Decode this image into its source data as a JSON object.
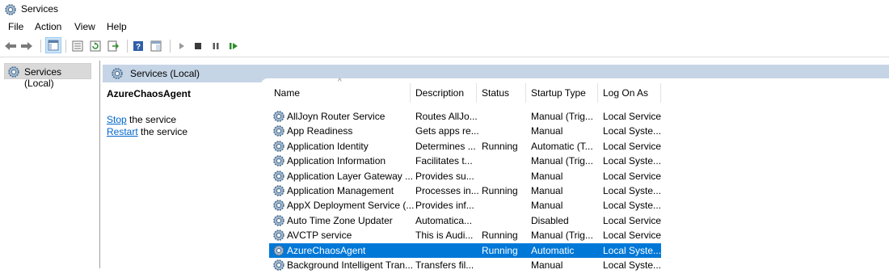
{
  "window": {
    "title": "Services"
  },
  "menu": [
    "File",
    "Action",
    "View",
    "Help"
  ],
  "toolbar": {
    "icons": [
      "back-arrow-icon",
      "forward-arrow-icon",
      "show-hide-tree-icon",
      "properties-icon",
      "refresh-icon",
      "export-list-icon",
      "help-icon",
      "console-view-icon",
      "start-service-icon",
      "stop-service-icon",
      "pause-service-icon",
      "restart-service-icon"
    ]
  },
  "tree": {
    "root_label": "Services (Local)"
  },
  "content_header": {
    "label": "Services (Local)"
  },
  "detail": {
    "service_name": "AzureChaosAgent",
    "stop_link": "Stop",
    "stop_rest": " the service",
    "restart_link": "Restart",
    "restart_rest": " the service"
  },
  "columns": [
    "Name",
    "Description",
    "Status",
    "Startup Type",
    "Log On As"
  ],
  "sort_indicator": "^",
  "services": [
    {
      "name": "AllJoyn Router Service",
      "description": "Routes AllJo...",
      "status": "",
      "startup": "Manual (Trig...",
      "logon": "Local Service"
    },
    {
      "name": "App Readiness",
      "description": "Gets apps re...",
      "status": "",
      "startup": "Manual",
      "logon": "Local Syste..."
    },
    {
      "name": "Application Identity",
      "description": "Determines ...",
      "status": "Running",
      "startup": "Automatic (T...",
      "logon": "Local Service"
    },
    {
      "name": "Application Information",
      "description": "Facilitates t...",
      "status": "",
      "startup": "Manual (Trig...",
      "logon": "Local Syste..."
    },
    {
      "name": "Application Layer Gateway ...",
      "description": "Provides su...",
      "status": "",
      "startup": "Manual",
      "logon": "Local Service"
    },
    {
      "name": "Application Management",
      "description": "Processes in...",
      "status": "Running",
      "startup": "Manual",
      "logon": "Local Syste..."
    },
    {
      "name": "AppX Deployment Service (...",
      "description": "Provides inf...",
      "status": "",
      "startup": "Manual",
      "logon": "Local Syste..."
    },
    {
      "name": "Auto Time Zone Updater",
      "description": "Automatica...",
      "status": "",
      "startup": "Disabled",
      "logon": "Local Service"
    },
    {
      "name": "AVCTP service",
      "description": "This is Audi...",
      "status": "Running",
      "startup": "Manual (Trig...",
      "logon": "Local Service"
    },
    {
      "name": "AzureChaosAgent",
      "description": "",
      "status": "Running",
      "startup": "Automatic",
      "logon": "Local Syste..."
    },
    {
      "name": "Background Intelligent Tran...",
      "description": "Transfers fil...",
      "status": "",
      "startup": "Manual",
      "logon": "Local Syste..."
    }
  ],
  "selected_service": "AzureChaosAgent",
  "colors": {
    "selection": "#0078d7",
    "header_band": "#c6d5e6",
    "link": "#0066cc"
  }
}
